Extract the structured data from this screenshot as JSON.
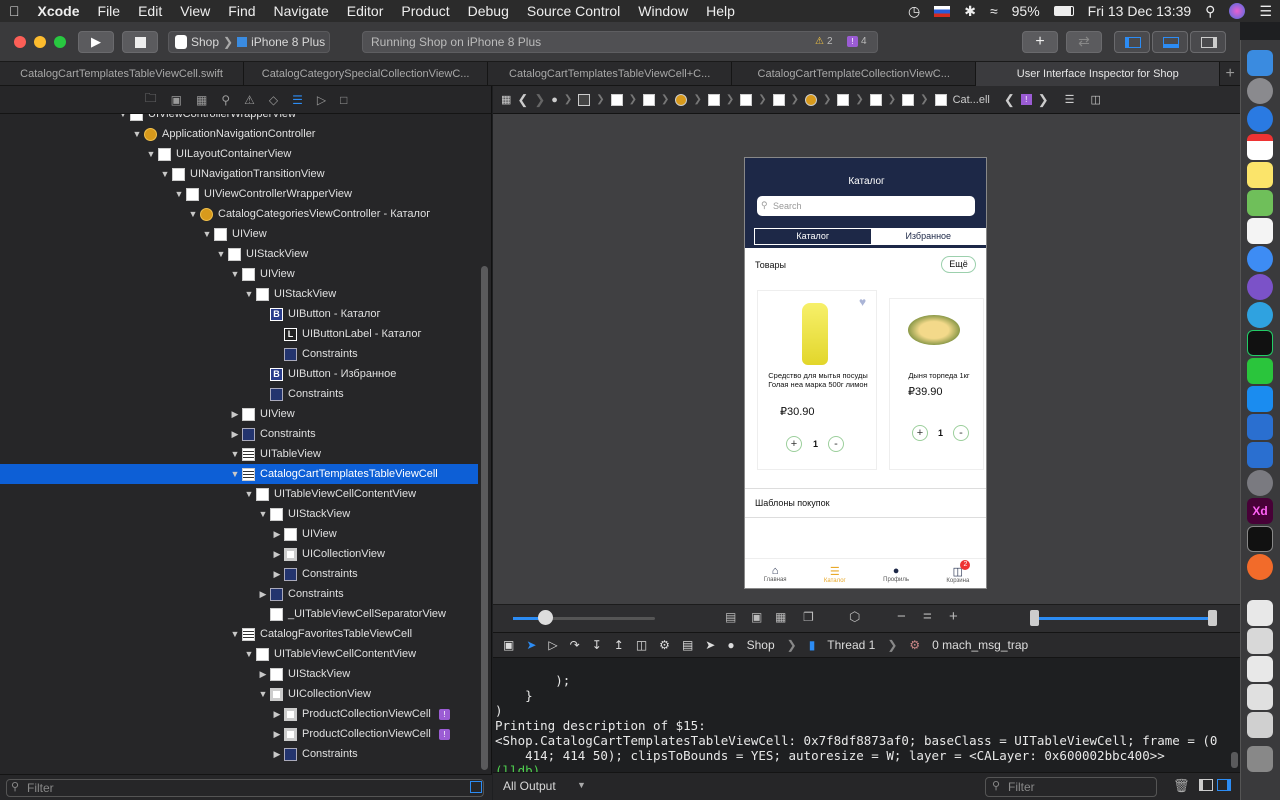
{
  "menubar": {
    "app": "Xcode",
    "items": [
      "File",
      "Edit",
      "View",
      "Find",
      "Navigate",
      "Editor",
      "Product",
      "Debug",
      "Source Control",
      "Window",
      "Help"
    ],
    "battery": "95%",
    "datetime": "Fri 13 Dec  13:39"
  },
  "toolbar": {
    "scheme": "Shop",
    "device": "iPhone 8 Plus",
    "activity": "Running Shop on iPhone 8 Plus",
    "warnings": "2",
    "issues": "4"
  },
  "tabs": [
    "CatalogCartTemplatesTableViewCell.swift",
    "CatalogCategorySpecialCollectionViewC...",
    "CatalogCartTemplatesTableViewCell+C...",
    "CatalogCartTemplateCollectionViewC...",
    "User Interface Inspector for Shop"
  ],
  "tree": [
    {
      "label": "UIViewControllerWrapperView",
      "indent": 8,
      "icon": "view",
      "disc": "▼"
    },
    {
      "label": "ApplicationNavigationController",
      "indent": 9,
      "icon": "vc",
      "disc": "▼"
    },
    {
      "label": "UILayoutContainerView",
      "indent": 10,
      "icon": "view",
      "disc": "▼"
    },
    {
      "label": "UINavigationTransitionView",
      "indent": 11,
      "icon": "view",
      "disc": "▼"
    },
    {
      "label": "UIViewControllerWrapperView",
      "indent": 12,
      "icon": "view",
      "disc": "▼"
    },
    {
      "label": "CatalogCategoriesViewController - Каталог",
      "indent": 13,
      "icon": "vc",
      "disc": "▼"
    },
    {
      "label": "UIView",
      "indent": 14,
      "icon": "view",
      "disc": "▼"
    },
    {
      "label": "UIStackView",
      "indent": 15,
      "icon": "view",
      "disc": "▼"
    },
    {
      "label": "UIView",
      "indent": 16,
      "icon": "view",
      "disc": "▼"
    },
    {
      "label": "UIStackView",
      "indent": 17,
      "icon": "view",
      "disc": "▼"
    },
    {
      "label": "UIButton - Каталог",
      "indent": 18,
      "icon": "b",
      "disc": ""
    },
    {
      "label": "UIButtonLabel - Каталог",
      "indent": 19,
      "icon": "l",
      "disc": ""
    },
    {
      "label": "Constraints",
      "indent": 19,
      "icon": "c",
      "disc": ""
    },
    {
      "label": "UIButton - Избранное",
      "indent": 18,
      "icon": "b",
      "disc": ""
    },
    {
      "label": "Constraints",
      "indent": 18,
      "icon": "c",
      "disc": ""
    },
    {
      "label": "UIView",
      "indent": 16,
      "icon": "view",
      "disc": "▶"
    },
    {
      "label": "Constraints",
      "indent": 16,
      "icon": "c",
      "disc": "▶"
    },
    {
      "label": "UITableView",
      "indent": 16,
      "icon": "t",
      "disc": "▼"
    },
    {
      "label": "CatalogCartTemplatesTableViewCell",
      "indent": 16,
      "icon": "t",
      "disc": "▼",
      "sel": true
    },
    {
      "label": "UITableViewCellContentView",
      "indent": 17,
      "icon": "view",
      "disc": "▼"
    },
    {
      "label": "UIStackView",
      "indent": 18,
      "icon": "view",
      "disc": "▼"
    },
    {
      "label": "UIView",
      "indent": 19,
      "icon": "view",
      "disc": "▶"
    },
    {
      "label": "UICollectionView",
      "indent": 19,
      "icon": "g",
      "disc": "▶"
    },
    {
      "label": "Constraints",
      "indent": 19,
      "icon": "c",
      "disc": "▶"
    },
    {
      "label": "Constraints",
      "indent": 18,
      "icon": "c",
      "disc": "▶"
    },
    {
      "label": "_UITableViewCellSeparatorView",
      "indent": 18,
      "icon": "view",
      "disc": ""
    },
    {
      "label": "CatalogFavoritesTableViewCell",
      "indent": 16,
      "icon": "t",
      "disc": "▼"
    },
    {
      "label": "UITableViewCellContentView",
      "indent": 17,
      "icon": "view",
      "disc": "▼"
    },
    {
      "label": "UIStackView",
      "indent": 18,
      "icon": "view",
      "disc": "▶"
    },
    {
      "label": "UICollectionView",
      "indent": 18,
      "icon": "g",
      "disc": "▼"
    },
    {
      "label": "ProductCollectionViewCell",
      "indent": 19,
      "icon": "g",
      "disc": "▶",
      "warn": true
    },
    {
      "label": "ProductCollectionViewCell",
      "indent": 19,
      "icon": "g",
      "disc": "▶",
      "warn": true
    },
    {
      "label": "Constraints",
      "indent": 19,
      "icon": "c",
      "disc": "▶"
    }
  ],
  "filter": {
    "placeholder": "Filter"
  },
  "jumpbar": {
    "last": "Cat...ell"
  },
  "debugbar": {
    "target": "Shop",
    "thread": "Thread 1",
    "frame": "0 mach_msg_trap"
  },
  "console": {
    "lines": [
      "        );",
      "    }",
      ")",
      "Printing description of $15:",
      "<Shop.CatalogCartTemplatesTableViewCell: 0x7f8df8873af0; baseClass = UITableViewCell; frame = (0",
      "    414; 414 50); clipsToBounds = YES; autoresize = W; layer = <CALayer: 0x600002bbc400>>"
    ],
    "prompt": "(lldb)",
    "output_selector": "All Output",
    "filter_placeholder": "Filter"
  },
  "phone": {
    "title": "Каталог",
    "search_placeholder": "Search",
    "segments": [
      "Каталог",
      "Избранное"
    ],
    "goods_label": "Товары",
    "more_button": "Ещё",
    "products": [
      {
        "name": "Средство для мытья посуды Голая неа марка 500г лимон",
        "price": "₽30.90",
        "qty": "1"
      },
      {
        "name": "Дыня торпеда 1кг",
        "price": "₽39.90",
        "qty": "1"
      }
    ],
    "templates_label": "Шаблоны покупок",
    "tabbar": [
      "Главная",
      "Каталог",
      "Профиль",
      "Корзина"
    ],
    "cart_badge": "2"
  },
  "colors": {
    "selection": "#0d5fd6",
    "phone_nav": "#1d2847",
    "accent_green": "#4fd34f"
  }
}
